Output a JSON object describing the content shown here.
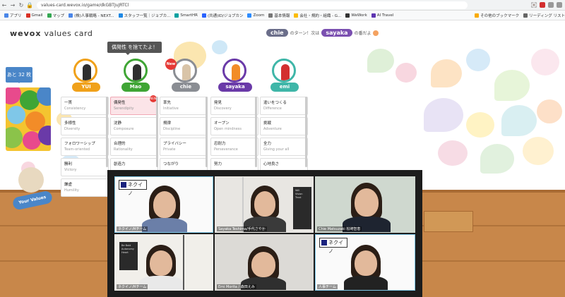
{
  "browser": {
    "url": "values-card.wevox.io/game/dkGBTJuJRTCl",
    "bookmarks": [
      "アプリ",
      "Gmail",
      "マップ",
      "(株)人事戦略 - NEXT...",
      "スタッフ一覧｜ジョブカ...",
      "SmartHR",
      "(共通)ID/ジョブカン",
      "Zoom",
      "基本情報",
      "会社・規約・組織 - G...",
      "WeWork",
      "AI Travel"
    ],
    "bookmarks_right": [
      "その他のブックマーク",
      "リーディング リスト"
    ]
  },
  "app": {
    "logo_prefix": "wevox",
    "logo_suffix": "values card",
    "turn": {
      "current": "chie",
      "text_mid": "のターン！次は",
      "next": "sayaka",
      "text_end": "の番だよ"
    },
    "remaining": "あと 32 枚",
    "mascot_label": "Your Values",
    "tooltip": "偶発性 を捨てたよ！",
    "new_badge": "New"
  },
  "players": [
    {
      "name": "YUI",
      "color": "#f0a11a"
    },
    {
      "name": "Mao",
      "color": "#3fa535"
    },
    {
      "name": "chie",
      "color": "#8a8d93"
    },
    {
      "name": "sayaka",
      "color": "#6a3aa8"
    },
    {
      "name": "emi",
      "color": "#3fb6a8"
    }
  ],
  "columns": [
    [
      {
        "jp": "一貫",
        "en": "Consistency"
      },
      {
        "jp": "多様性",
        "en": "Diversity"
      },
      {
        "jp": "フォロワーシップ",
        "en": "Team-oriented"
      },
      {
        "jp": "勝利",
        "en": "Victory"
      },
      {
        "jp": "謙虚",
        "en": "Humility"
      }
    ],
    [
      {
        "jp": "偶発性",
        "en": "Serendipity",
        "selected": true,
        "new": "NEW"
      },
      {
        "jp": "沈静",
        "en": "Composure"
      },
      {
        "jp": "合理的",
        "en": "Rationality"
      },
      {
        "jp": "創造力",
        "en": ""
      }
    ],
    [
      {
        "jp": "率先",
        "en": "Initiative"
      },
      {
        "jp": "規律",
        "en": "Discipline"
      },
      {
        "jp": "プライバシー",
        "en": "Private"
      },
      {
        "jp": "つながり",
        "en": ""
      }
    ],
    [
      {
        "jp": "発見",
        "en": "Discovery"
      },
      {
        "jp": "オープン",
        "en": "Open mindness"
      },
      {
        "jp": "忍耐力",
        "en": "Perseverance"
      },
      {
        "jp": "努力",
        "en": ""
      }
    ],
    [
      {
        "jp": "違いをつくる",
        "en": "Difference"
      },
      {
        "jp": "挑戦",
        "en": "Adventure"
      },
      {
        "jp": "全力",
        "en": "Giving your all"
      },
      {
        "jp": "心地良さ",
        "en": ""
      }
    ]
  ],
  "zoom": {
    "tiles": [
      {
        "label": "ネクイノ/Hチーム",
        "active": true
      },
      {
        "label": "Sayaka Teshima/手代さやか",
        "active": false
      },
      {
        "label": "Chie Matsuzaki 松崎智恵",
        "active": false
      },
      {
        "label": "ネクイノ/Hチーム",
        "active": false
      },
      {
        "label": "Emi Morita / 森田えみ",
        "active": false
      },
      {
        "label": "人事チーム",
        "active": true
      }
    ],
    "brand": "ネクイノ"
  }
}
